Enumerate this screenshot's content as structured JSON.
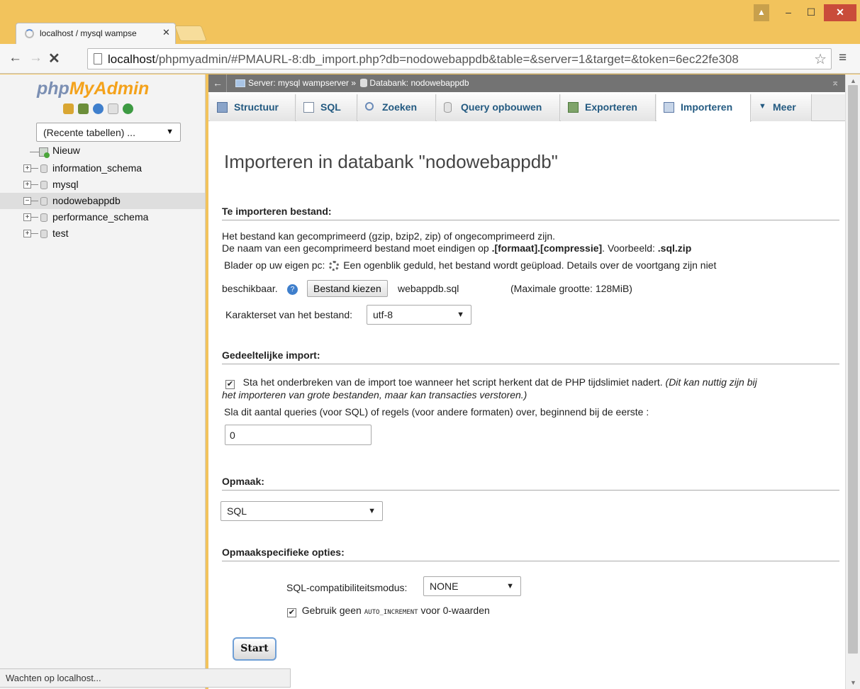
{
  "browser": {
    "tab_title": "localhost / mysql wampse",
    "url_host": "localhost",
    "url_path": "/phpmyadmin/#PMAURL-8:db_import.php?db=nodowebappdb&table=&server=1&target=&token=6ec22fe308",
    "status": "Wachten op localhost..."
  },
  "sidebar": {
    "logo_php": "php",
    "logo_myadmin": "MyAdmin",
    "recent_select": "(Recente tabellen) ...",
    "tree": [
      {
        "label": "Nieuw",
        "type": "new"
      },
      {
        "label": "information_schema",
        "type": "db"
      },
      {
        "label": "mysql",
        "type": "db"
      },
      {
        "label": "nodowebappdb",
        "type": "db",
        "active": true
      },
      {
        "label": "performance_schema",
        "type": "db"
      },
      {
        "label": "test",
        "type": "db"
      }
    ]
  },
  "breadcrumb": {
    "server": "Server: mysql wampserver",
    "separator": "»",
    "database": "Databank: nodowebappdb"
  },
  "tabs": [
    {
      "label": "Structuur",
      "icon": "structure-icon"
    },
    {
      "label": "SQL",
      "icon": "sql-icon"
    },
    {
      "label": "Zoeken",
      "icon": "search-icon"
    },
    {
      "label": "Query opbouwen",
      "icon": "query-icon"
    },
    {
      "label": "Exporteren",
      "icon": "export-icon"
    },
    {
      "label": "Importeren",
      "icon": "import-icon",
      "active": true
    },
    {
      "label": "Meer",
      "icon": "caret-down-icon"
    }
  ],
  "page": {
    "title": "Importeren in databank \"nodowebappdb\"",
    "file_section": {
      "heading": "Te importeren bestand:",
      "line1": "Het bestand kan gecomprimeerd (gzip, bzip2, zip) of ongecomprimeerd zijn.",
      "line2_prefix": "De naam van een gecomprimeerd bestand moet eindigen op ",
      "line2_bold": ".[formaat].[compressie]",
      "line2_mid": ". Voorbeeld: ",
      "line2_example": ".sql.zip",
      "browse_prefix": "Blader op uw eigen pc:",
      "browse_wait": "Een ogenblik geduld, het bestand wordt geüpload. Details over de voortgang zijn niet",
      "browse_wait2": "beschikbaar.",
      "file_button": "Bestand kiezen",
      "file_name": "webappdb.sql",
      "max_size": "(Maximale grootte: 128MiB)",
      "charset_label": "Karakterset van het bestand:",
      "charset_value": "utf-8"
    },
    "partial_section": {
      "heading": "Gedeeltelijke import:",
      "checkbox_checked": true,
      "checkbox_text": "Sta het onderbreken van de import toe wanneer het script herkent dat de PHP tijdslimiet nadert.",
      "checkbox_note_1": "(Dit kan nuttig zijn bij",
      "checkbox_note_2": "het importeren van grote bestanden, maar kan transacties verstoren.)",
      "skip_label": "Sla dit aantal queries (voor SQL) of regels (voor andere formaten) over, beginnend bij de eerste :",
      "skip_value": "0"
    },
    "format_section": {
      "heading": "Opmaak:",
      "format_value": "SQL"
    },
    "options_section": {
      "heading": "Opmaakspecifieke opties:",
      "compat_label": "SQL-compatibiliteitsmodus:",
      "compat_value": "NONE",
      "auto_inc_checked": true,
      "auto_inc_prefix": "Gebruik geen",
      "auto_inc_code": "AUTO_INCREMENT",
      "auto_inc_suffix": "voor 0-waarden"
    },
    "submit_label": "Start"
  }
}
